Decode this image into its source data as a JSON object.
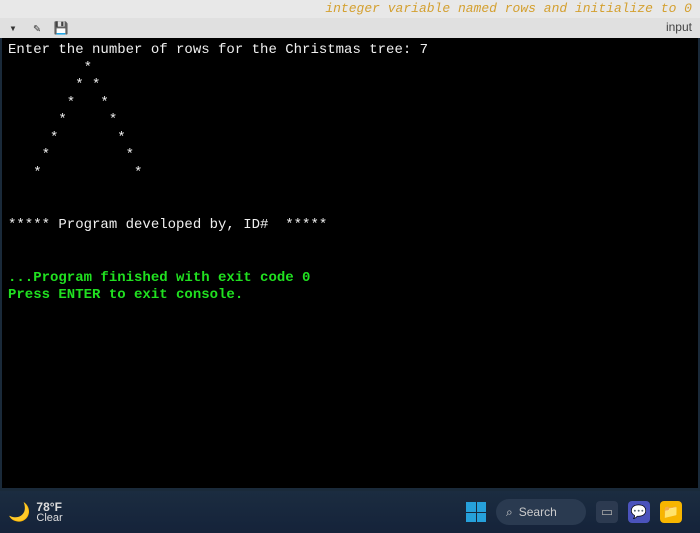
{
  "header": {
    "comment_fragment": "integer variable named rows and initialize to 0",
    "input_label": "input"
  },
  "toolbar": {
    "icons": [
      "chevron-down",
      "edit",
      "save"
    ]
  },
  "terminal": {
    "prompt_line": "Enter the number of rows for the Christmas tree: 7",
    "tree_lines": [
      "         *",
      "        * *",
      "       *   *",
      "      *     *",
      "     *       *",
      "    *         *",
      "   *           *"
    ],
    "signature_line": "***** Program developed by, ID#  *****",
    "exit_line": "...Program finished with exit code 0",
    "press_line": "Press ENTER to exit console."
  },
  "taskbar": {
    "weather": {
      "temp": "78°F",
      "condition": "Clear"
    },
    "search_label": "Search"
  }
}
